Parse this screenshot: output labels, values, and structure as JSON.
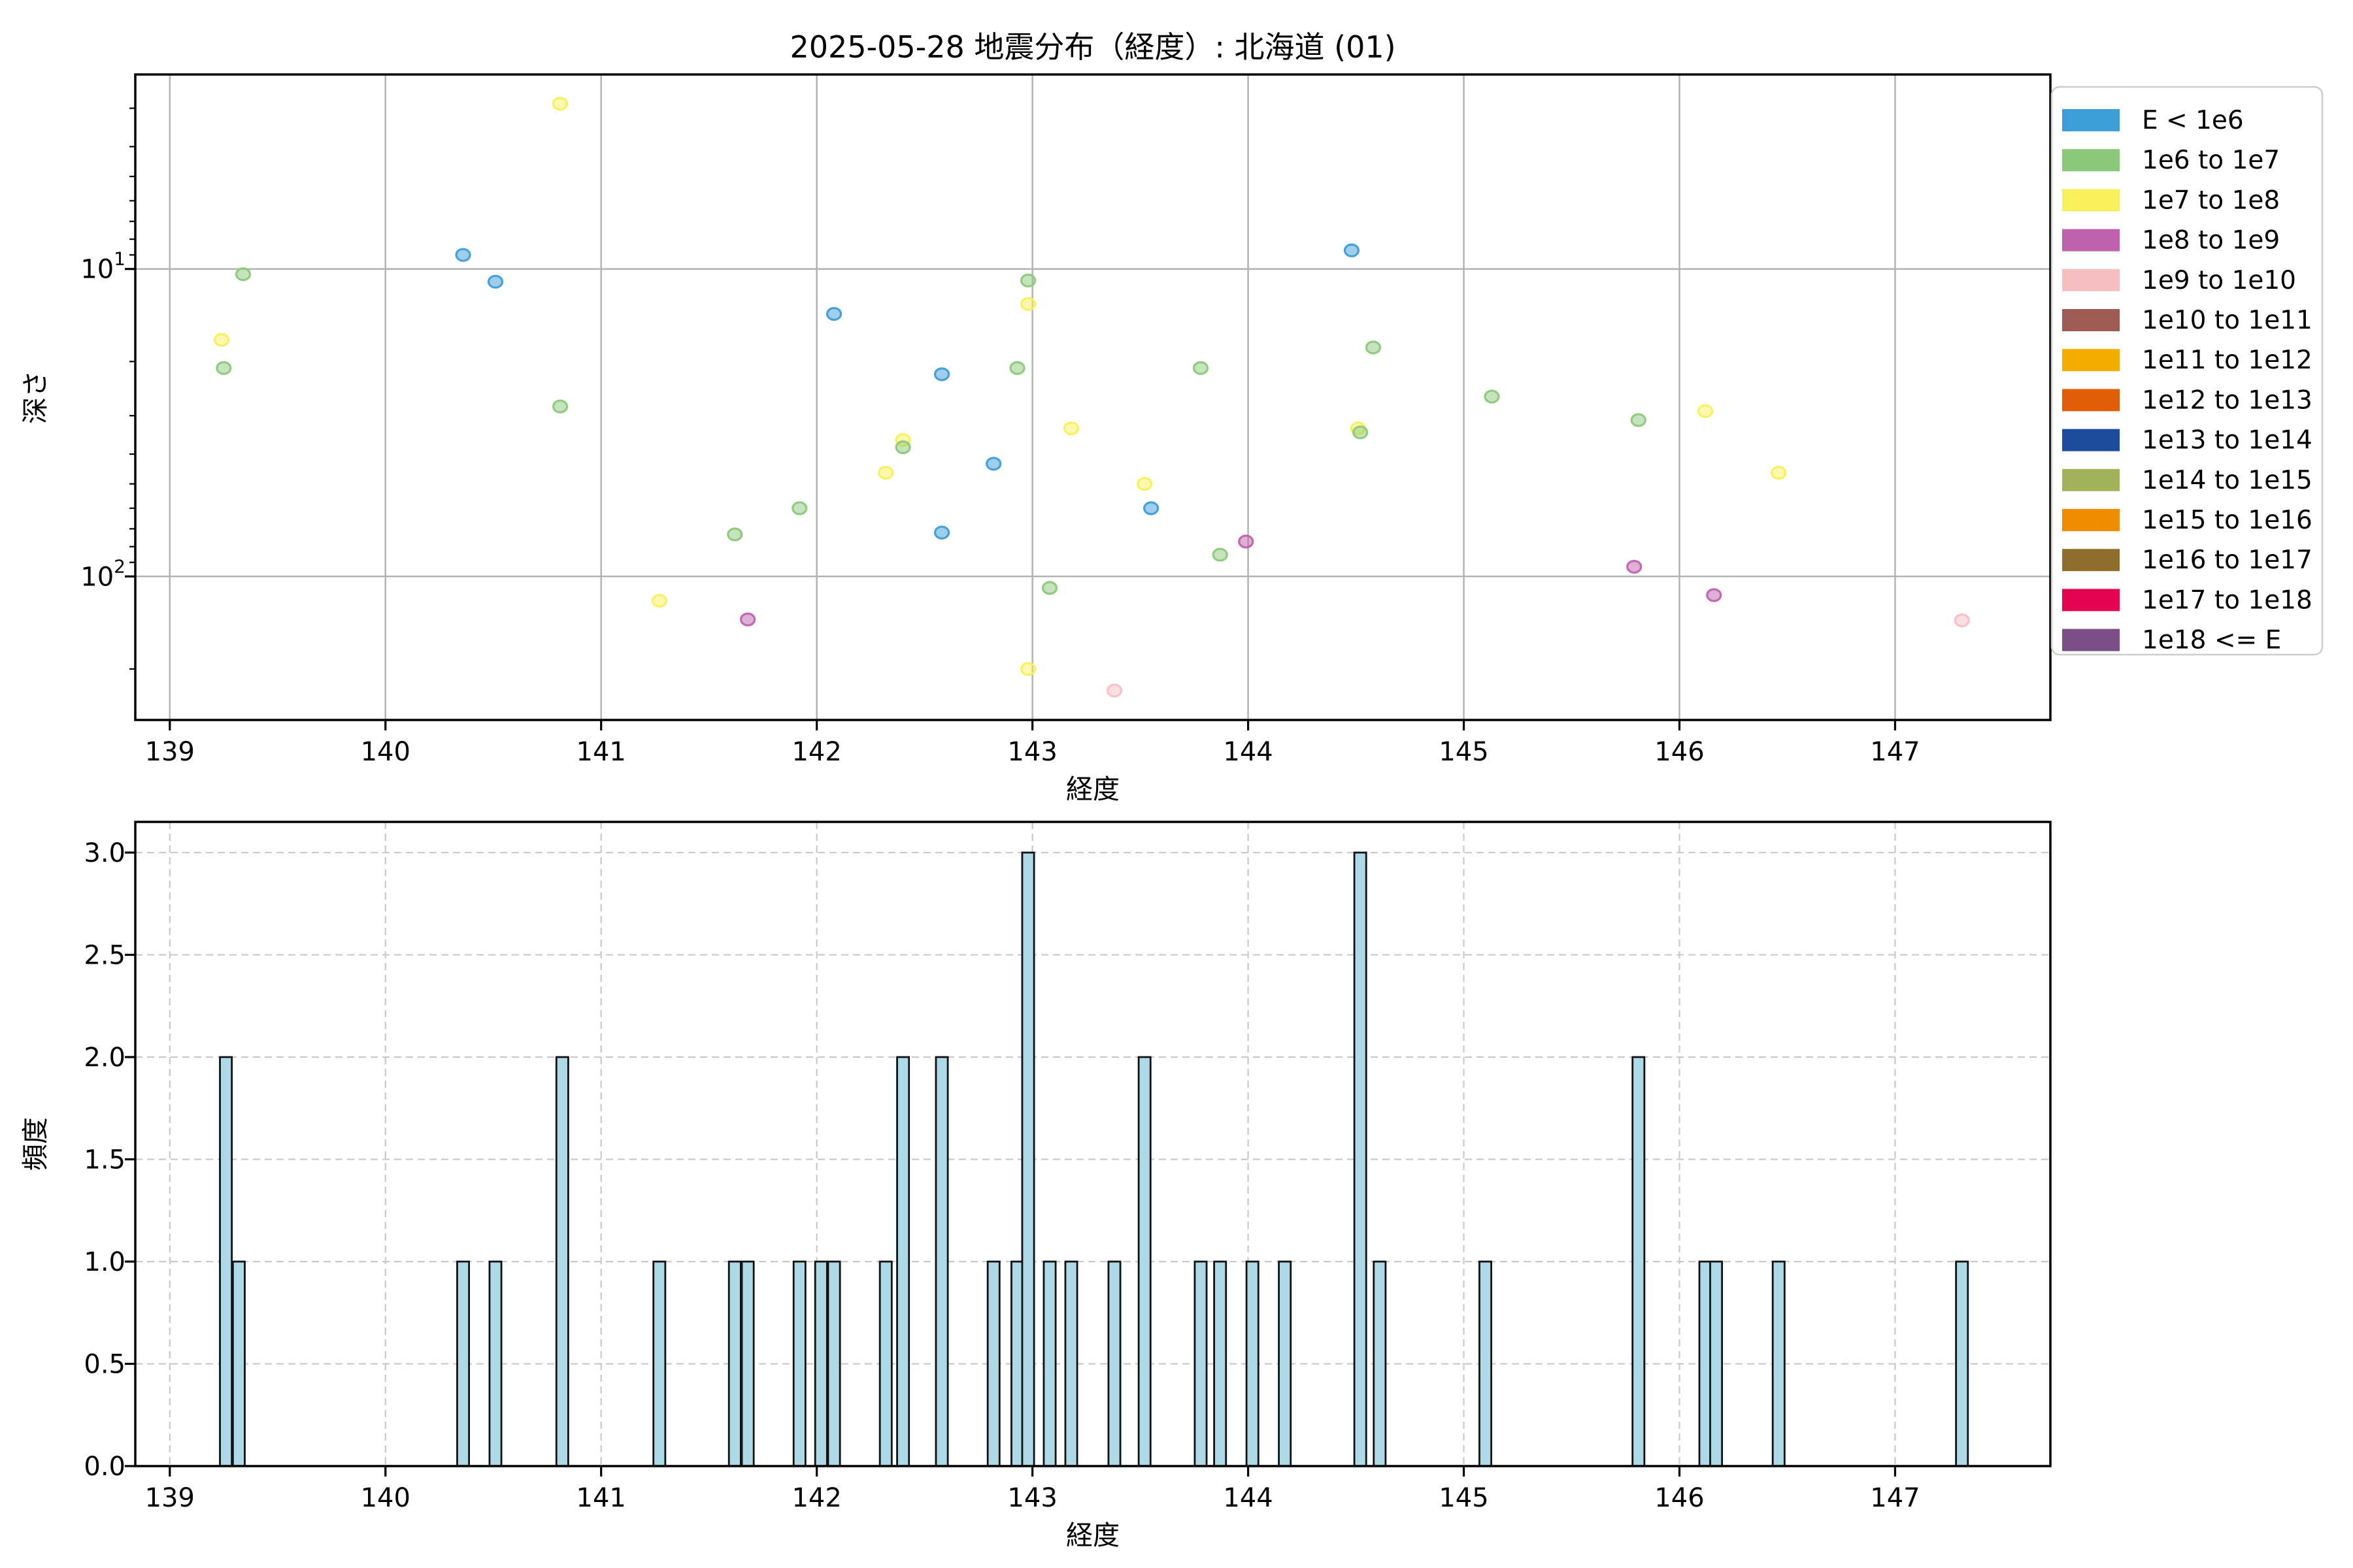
{
  "title": "2025-05-28 地震分布（経度）: 北海道 (01)",
  "chart_data": [
    {
      "type": "scatter",
      "title": "2025-05-28 地震分布（経度）: 北海道 (01)",
      "xlabel": "経度",
      "ylabel": "深さ",
      "xlim": [
        138.84,
        147.72
      ],
      "ylim_depth_top_to_bottom": [
        2.33,
        293
      ],
      "yscale": "log-inverted-depth",
      "xticks": [
        139,
        140,
        141,
        142,
        143,
        144,
        145,
        146,
        147
      ],
      "yticks": [
        10,
        100
      ],
      "ytick_labels": [
        "10^1",
        "10^2"
      ],
      "minor_yticks": [
        3,
        4,
        5,
        6,
        7,
        8,
        9,
        20,
        30,
        40,
        50,
        60,
        70,
        80,
        90,
        200
      ],
      "grid": "solid",
      "legend_position": "upper right outside",
      "points": [
        {
          "lon": 139.24,
          "depth": 17,
          "energy": "1e7 to 1e8"
        },
        {
          "lon": 139.25,
          "depth": 21,
          "energy": "1e6 to 1e7"
        },
        {
          "lon": 139.34,
          "depth": 10.4,
          "energy": "1e6 to 1e7"
        },
        {
          "lon": 140.36,
          "depth": 9.0,
          "energy": "E < 1e6"
        },
        {
          "lon": 140.51,
          "depth": 11,
          "energy": "E < 1e6"
        },
        {
          "lon": 140.81,
          "depth": 2.9,
          "energy": "1e7 to 1e8"
        },
        {
          "lon": 140.81,
          "depth": 28,
          "energy": "1e6 to 1e7"
        },
        {
          "lon": 141.27,
          "depth": 120,
          "energy": "1e7 to 1e8"
        },
        {
          "lon": 141.62,
          "depth": 73,
          "energy": "1e6 to 1e7"
        },
        {
          "lon": 141.68,
          "depth": 138,
          "energy": "1e8 to 1e9"
        },
        {
          "lon": 141.92,
          "depth": 60,
          "energy": "1e6 to 1e7"
        },
        {
          "lon": 142.08,
          "depth": 14,
          "energy": "E < 1e6"
        },
        {
          "lon": 142.32,
          "depth": 46,
          "energy": "1e7 to 1e8"
        },
        {
          "lon": 142.4,
          "depth": 36,
          "energy": "1e7 to 1e8"
        },
        {
          "lon": 142.4,
          "depth": 38,
          "energy": "1e6 to 1e7"
        },
        {
          "lon": 142.58,
          "depth": 22,
          "energy": "E < 1e6"
        },
        {
          "lon": 142.58,
          "depth": 72,
          "energy": "E < 1e6"
        },
        {
          "lon": 142.82,
          "depth": 43,
          "energy": "E < 1e6"
        },
        {
          "lon": 142.93,
          "depth": 21,
          "energy": "1e6 to 1e7"
        },
        {
          "lon": 142.98,
          "depth": 10.9,
          "energy": "1e6 to 1e7"
        },
        {
          "lon": 142.98,
          "depth": 13,
          "energy": "1e7 to 1e8"
        },
        {
          "lon": 142.98,
          "depth": 200,
          "energy": "1e7 to 1e8"
        },
        {
          "lon": 143.08,
          "depth": 109,
          "energy": "1e6 to 1e7"
        },
        {
          "lon": 143.18,
          "depth": 33,
          "energy": "1e7 to 1e8"
        },
        {
          "lon": 143.38,
          "depth": 235,
          "energy": "1e9 to 1e10"
        },
        {
          "lon": 143.52,
          "depth": 50,
          "energy": "1e7 to 1e8"
        },
        {
          "lon": 143.55,
          "depth": 60,
          "energy": "E < 1e6"
        },
        {
          "lon": 143.78,
          "depth": 21,
          "energy": "1e6 to 1e7"
        },
        {
          "lon": 143.87,
          "depth": 85,
          "energy": "1e6 to 1e7"
        },
        {
          "lon": 143.99,
          "depth": 77,
          "energy": "1e8 to 1e9"
        },
        {
          "lon": 144.48,
          "depth": 8.7,
          "energy": "E < 1e6"
        },
        {
          "lon": 144.51,
          "depth": 33,
          "energy": "1e7 to 1e8"
        },
        {
          "lon": 144.52,
          "depth": 34,
          "energy": "1e6 to 1e7"
        },
        {
          "lon": 144.58,
          "depth": 18,
          "energy": "1e6 to 1e7"
        },
        {
          "lon": 145.13,
          "depth": 26,
          "energy": "1e6 to 1e7"
        },
        {
          "lon": 145.79,
          "depth": 93,
          "energy": "1e8 to 1e9"
        },
        {
          "lon": 145.81,
          "depth": 31,
          "energy": "1e6 to 1e7"
        },
        {
          "lon": 146.12,
          "depth": 29,
          "energy": "1e7 to 1e8"
        },
        {
          "lon": 146.16,
          "depth": 115,
          "energy": "1e8 to 1e9"
        },
        {
          "lon": 146.46,
          "depth": 46,
          "energy": "1e7 to 1e8"
        },
        {
          "lon": 147.31,
          "depth": 139,
          "energy": "1e9 to 1e10"
        }
      ]
    },
    {
      "type": "bar",
      "xlabel": "経度",
      "ylabel": "頻度",
      "xlim": [
        138.84,
        147.72
      ],
      "ylim": [
        0,
        3.15
      ],
      "xticks": [
        139,
        140,
        141,
        142,
        143,
        144,
        145,
        146,
        147
      ],
      "ytick_labels": [
        "0.0",
        "0.5",
        "1.0",
        "1.5",
        "2.0",
        "2.5",
        "3.0"
      ],
      "grid": "dashed",
      "bar_color": "#ADD8E6",
      "bar_edge_color": "#111111",
      "bin_width_lon": 0.055,
      "bars": [
        {
          "lon": 139.26,
          "count": 2
        },
        {
          "lon": 139.32,
          "count": 1
        },
        {
          "lon": 140.36,
          "count": 1
        },
        {
          "lon": 140.51,
          "count": 1
        },
        {
          "lon": 140.82,
          "count": 2
        },
        {
          "lon": 141.27,
          "count": 1
        },
        {
          "lon": 141.62,
          "count": 1
        },
        {
          "lon": 141.68,
          "count": 1
        },
        {
          "lon": 141.92,
          "count": 1
        },
        {
          "lon": 142.02,
          "count": 1
        },
        {
          "lon": 142.08,
          "count": 1
        },
        {
          "lon": 142.32,
          "count": 1
        },
        {
          "lon": 142.4,
          "count": 2
        },
        {
          "lon": 142.58,
          "count": 2
        },
        {
          "lon": 142.82,
          "count": 1
        },
        {
          "lon": 142.93,
          "count": 1
        },
        {
          "lon": 142.98,
          "count": 3
        },
        {
          "lon": 143.08,
          "count": 1
        },
        {
          "lon": 143.18,
          "count": 1
        },
        {
          "lon": 143.38,
          "count": 1
        },
        {
          "lon": 143.52,
          "count": 2
        },
        {
          "lon": 143.78,
          "count": 1
        },
        {
          "lon": 143.87,
          "count": 1
        },
        {
          "lon": 144.02,
          "count": 1
        },
        {
          "lon": 144.17,
          "count": 1
        },
        {
          "lon": 144.52,
          "count": 3
        },
        {
          "lon": 144.61,
          "count": 1
        },
        {
          "lon": 145.1,
          "count": 1
        },
        {
          "lon": 145.81,
          "count": 2
        },
        {
          "lon": 146.12,
          "count": 1
        },
        {
          "lon": 146.17,
          "count": 1
        },
        {
          "lon": 146.46,
          "count": 1
        },
        {
          "lon": 147.31,
          "count": 1
        }
      ]
    }
  ],
  "legend": {
    "entries": [
      {
        "label": "E < 1e6",
        "color": "#3D9DD7"
      },
      {
        "label": "1e6 to 1e7",
        "color": "#8CC87A"
      },
      {
        "label": "1e7 to 1e8",
        "color": "#F7F05C"
      },
      {
        "label": "1e8 to 1e9",
        "color": "#BF62AE"
      },
      {
        "label": "1e9 to 1e10",
        "color": "#F5BFC2"
      },
      {
        "label": "1e10 to 1e11",
        "color": "#9D5B53"
      },
      {
        "label": "1e11 to 1e12",
        "color": "#F2AD00"
      },
      {
        "label": "1e12 to 1e13",
        "color": "#E25D08"
      },
      {
        "label": "1e13 to 1e14",
        "color": "#1E4C9C"
      },
      {
        "label": "1e14 to 1e15",
        "color": "#A2B25A"
      },
      {
        "label": "1e15 to 1e16",
        "color": "#F08C00"
      },
      {
        "label": "1e16 to 1e17",
        "color": "#8F6E2D"
      },
      {
        "label": "1e17 to 1e18",
        "color": "#E40350"
      },
      {
        "label": "1e18 <= E",
        "color": "#7C4E87"
      }
    ]
  },
  "style_colors": {
    "grid_solid": "#B3B3B3",
    "grid_dashed": "#C9C9C9",
    "spine": "#000000",
    "legend_border": "#CCCCCC",
    "background": "#FFFFFF"
  }
}
